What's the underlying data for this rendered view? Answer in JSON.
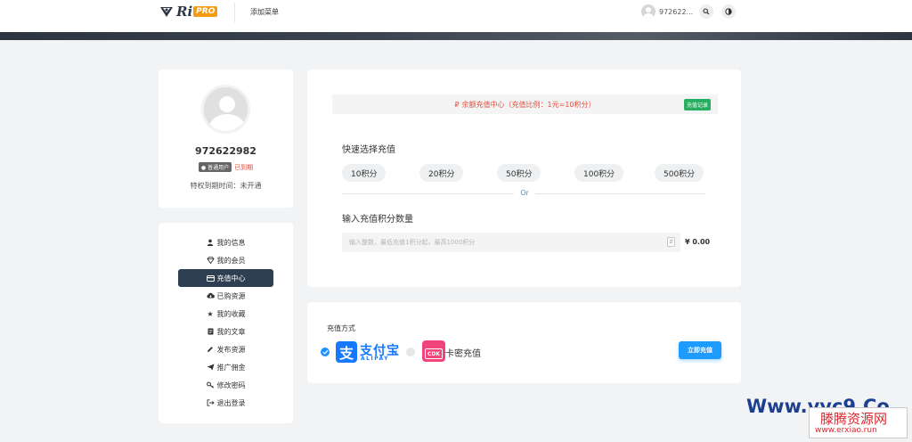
{
  "header": {
    "brand": "Ri",
    "brand_badge": "PRO",
    "nav_label": "添加菜单",
    "user_name": "972622...",
    "search_icon": "search-icon",
    "theme_icon": "half-moon-icon"
  },
  "profile": {
    "username": "972622982",
    "level_badge": "普通用户",
    "status": "已到期",
    "vip_expiry_text": "特权到期时间：未开通"
  },
  "menu": {
    "items": [
      {
        "label": "我的信息",
        "icon": "user-icon"
      },
      {
        "label": "我的会员",
        "icon": "diamond-icon"
      },
      {
        "label": "充值中心",
        "icon": "credit-card-icon",
        "active": true
      },
      {
        "label": "已购资源",
        "icon": "cloud-download-icon"
      },
      {
        "label": "我的收藏",
        "icon": "star-icon"
      },
      {
        "label": "我的文章",
        "icon": "document-icon"
      },
      {
        "label": "发布资源",
        "icon": "pencil-icon"
      },
      {
        "label": "推广佣金",
        "icon": "paper-plane-icon"
      },
      {
        "label": "修改密码",
        "icon": "key-icon"
      },
      {
        "label": "退出登录",
        "icon": "sign-out-icon"
      }
    ]
  },
  "recharge": {
    "notice": "余额充值中心（充值比例：1元=10积分）",
    "records_button": "充值记录",
    "quick_label": "快速选择充值",
    "presets": [
      "10积分",
      "20积分",
      "50积分",
      "100积分",
      "500积分"
    ],
    "or_text": "Or",
    "custom_label": "输入充值积分数量",
    "input_placeholder": "输入整数，最低充值1积分起，最高1000积分",
    "price": "¥ 0.00"
  },
  "payment": {
    "label": "充值方式",
    "alipay_cn": "支付宝",
    "alipay_en": "ALIPAY",
    "cdk_badge": "CDK",
    "card_label": "卡密充值",
    "pay_button": "立即充值"
  },
  "watermark": {
    "latin": "Www.vyc9.Co",
    "cn": "滕腾资源网",
    "url": "www.erxiao.run"
  },
  "colors": {
    "accent": "#2f3f53",
    "notice_red": "#e74c3c",
    "records_green": "#27ae60",
    "alipay_blue": "#1677ff",
    "cdk_pink": "#f0457a",
    "pay_button_blue": "#1e9bff"
  }
}
